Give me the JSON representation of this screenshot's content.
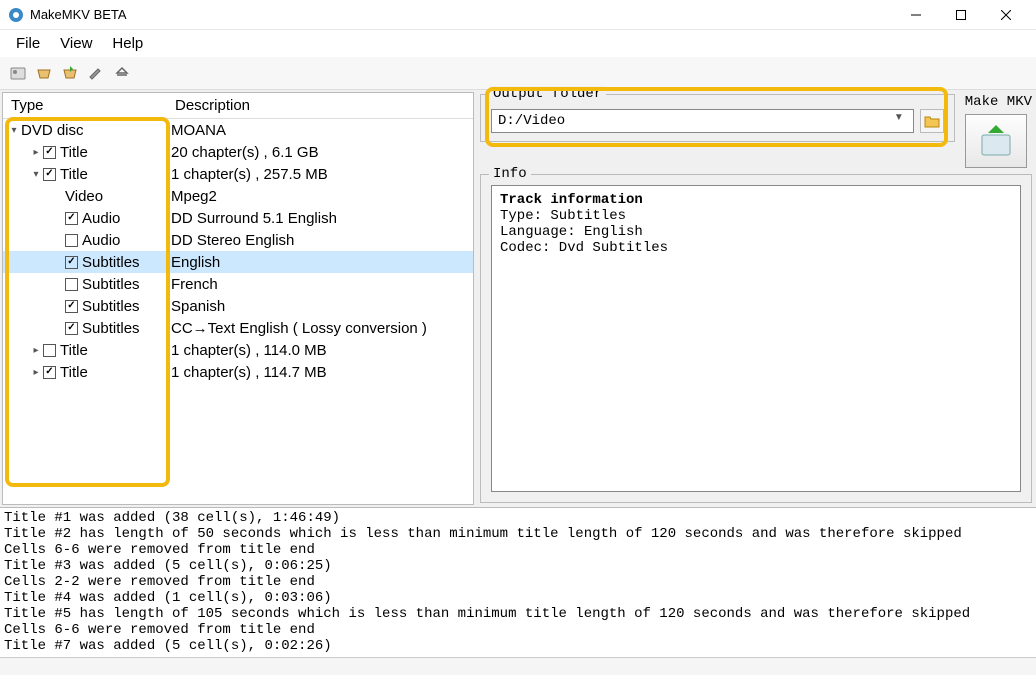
{
  "window": {
    "title": "MakeMKV BETA"
  },
  "menu": {
    "file": "File",
    "view": "View",
    "help": "Help"
  },
  "tree": {
    "headers": {
      "type": "Type",
      "desc": "Description"
    },
    "rows": [
      {
        "indent": 0,
        "expander": "v",
        "checkbox": null,
        "type": "DVD disc",
        "desc": "MOANA",
        "selected": false
      },
      {
        "indent": 1,
        "expander": ">",
        "checkbox": true,
        "type": "Title",
        "desc": "20 chapter(s) , 6.1 GB",
        "selected": false
      },
      {
        "indent": 1,
        "expander": "v",
        "checkbox": true,
        "type": "Title",
        "desc": "1 chapter(s) , 257.5 MB",
        "selected": false
      },
      {
        "indent": 2,
        "expander": "",
        "checkbox": null,
        "type": "Video",
        "desc": "Mpeg2",
        "selected": false
      },
      {
        "indent": 2,
        "expander": "",
        "checkbox": true,
        "type": "Audio",
        "desc": "DD Surround 5.1 English",
        "selected": false
      },
      {
        "indent": 2,
        "expander": "",
        "checkbox": false,
        "type": "Audio",
        "desc": "DD Stereo English",
        "selected": false
      },
      {
        "indent": 2,
        "expander": "",
        "checkbox": true,
        "type": "Subtitles",
        "desc": "English",
        "selected": true
      },
      {
        "indent": 2,
        "expander": "",
        "checkbox": false,
        "type": "Subtitles",
        "desc": "French",
        "selected": false
      },
      {
        "indent": 2,
        "expander": "",
        "checkbox": true,
        "type": "Subtitles",
        "desc": "Spanish",
        "selected": false
      },
      {
        "indent": 2,
        "expander": "",
        "checkbox": true,
        "type": "Subtitles",
        "desc": "CC→Text English ( Lossy conversion )",
        "selected": false
      },
      {
        "indent": 1,
        "expander": ">",
        "checkbox": false,
        "type": "Title",
        "desc": "1 chapter(s) , 114.0 MB",
        "selected": false
      },
      {
        "indent": 1,
        "expander": ">",
        "checkbox": true,
        "type": "Title",
        "desc": "1 chapter(s) , 114.7 MB",
        "selected": false
      }
    ]
  },
  "output": {
    "label": "Output folder",
    "value": "D:/Video"
  },
  "makemkv": {
    "label": "Make MKV"
  },
  "info": {
    "label": "Info",
    "heading": "Track information",
    "lines": "Type: Subtitles\nLanguage: English\nCodec: Dvd Subtitles"
  },
  "log": "Title #1 was added (38 cell(s), 1:46:49)\nTitle #2 has length of 50 seconds which is less than minimum title length of 120 seconds and was therefore skipped\nCells 6-6 were removed from title end\nTitle #3 was added (5 cell(s), 0:06:25)\nCells 2-2 were removed from title end\nTitle #4 was added (1 cell(s), 0:03:06)\nTitle #5 has length of 105 seconds which is less than minimum title length of 120 seconds and was therefore skipped\nCells 6-6 were removed from title end\nTitle #7 was added (5 cell(s), 0:02:26)"
}
